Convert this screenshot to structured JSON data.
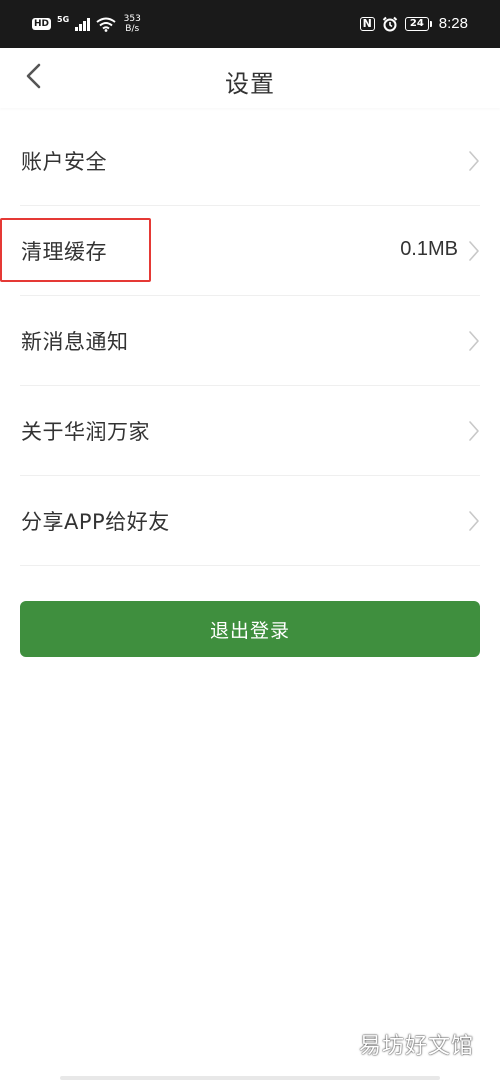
{
  "status_bar": {
    "hd_label": "HD",
    "network_label": "5G",
    "net_speed_value": "353",
    "net_speed_unit": "B/s",
    "nfc_label": "N",
    "battery_level": "24",
    "time": "8:28"
  },
  "header": {
    "back_icon": "chevron-left-icon",
    "title": "设置"
  },
  "settings": {
    "items": [
      {
        "label": "账户安全",
        "value": ""
      },
      {
        "label": "清理缓存",
        "value": "0.1MB"
      },
      {
        "label": "新消息通知",
        "value": ""
      },
      {
        "label": "关于华润万家",
        "value": ""
      },
      {
        "label": "分享APP给好友",
        "value": ""
      }
    ]
  },
  "actions": {
    "logout_label": "退出登录"
  },
  "watermark": "易坊好文馆",
  "colors": {
    "primary_green": "#3f8f3e",
    "highlight_red": "#e53935",
    "status_bar_bg": "#1a1a1a",
    "text_primary": "#333333",
    "chevron": "#c8c8c8"
  }
}
